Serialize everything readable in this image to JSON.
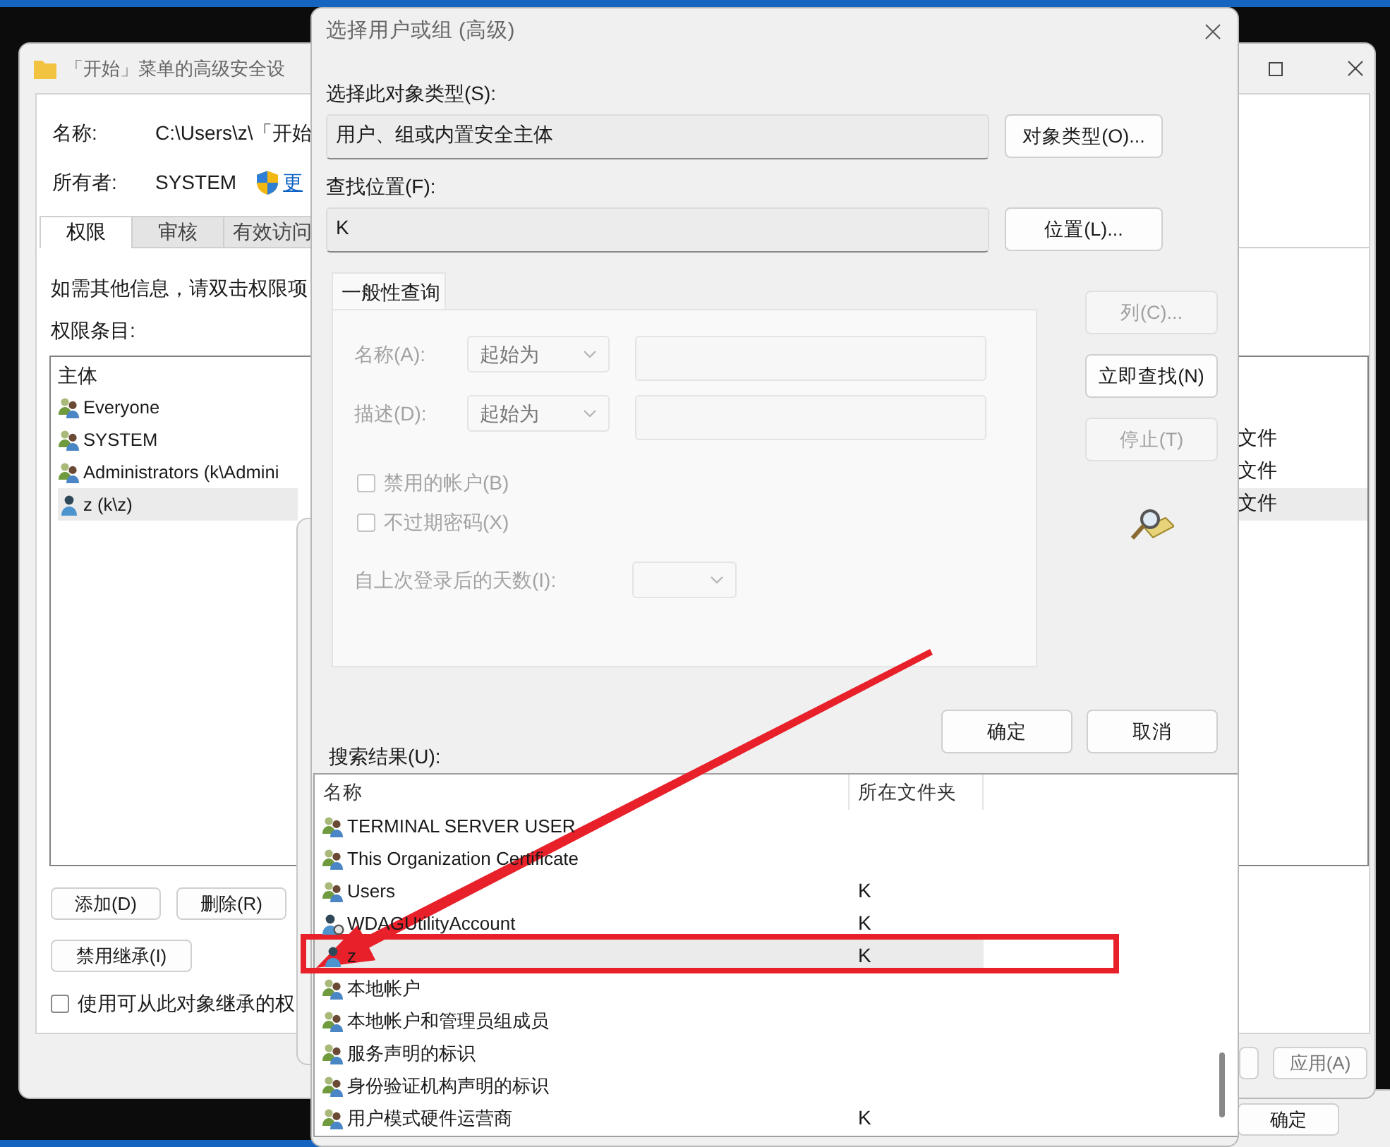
{
  "back_window": {
    "buttons": [
      "确定"
    ]
  },
  "security_window": {
    "title": "「开始」菜单的高级安全设",
    "name_label": "名称:",
    "name_value": "C:\\Users\\z\\「开始",
    "owner_label": "所有者:",
    "owner_value": "SYSTEM",
    "change_link": "更",
    "tabs": [
      {
        "label": "权限",
        "selected": true
      },
      {
        "label": "审核",
        "selected": false
      },
      {
        "label": "有效访问",
        "selected": false
      }
    ],
    "info_text": "如需其他信息，请双击权限项",
    "entries_label": "权限条目:",
    "entries": {
      "columns": [
        "主体"
      ],
      "rows": [
        {
          "kind": "group",
          "principal": "Everyone",
          "selected": false
        },
        {
          "kind": "group",
          "principal": "SYSTEM",
          "column_2": "文件",
          "selected": false
        },
        {
          "kind": "group",
          "principal": "Administrators (k\\Admini",
          "column_2": "文件",
          "selected": false
        },
        {
          "kind": "user",
          "principal": "z (k\\z)",
          "column_2": "文件",
          "selected": true
        }
      ]
    },
    "buttons": [
      "添加(D)",
      "删除(R)"
    ],
    "inherit_button": "禁用继承(I)",
    "inherit_checkbox": {
      "label": "使用可从此对象继承的权",
      "checked": false
    },
    "footer_buttons": [
      "应用(A)"
    ]
  },
  "dialog": {
    "title": "选择用户或组 (高级)",
    "object_type": {
      "label": "选择此对象类型(S):",
      "value": "用户、组或内置安全主体",
      "button": "对象类型(O)..."
    },
    "location": {
      "label": "查找位置(F):",
      "value": "K",
      "button": "位置(L)..."
    },
    "query_tab": {
      "label": "一般性查询",
      "selected": true
    },
    "query": {
      "disabled": true,
      "name_row": {
        "label": "名称(A):",
        "mode": "起始为"
      },
      "description_row": {
        "label": "描述(D):",
        "mode": "起始为"
      },
      "checkboxes": [
        {
          "label": "禁用的帐户(B)",
          "checked": false
        },
        {
          "label": "不过期密码(X)",
          "checked": false
        }
      ],
      "days_label": "自上次登录后的天数(I):"
    },
    "side_buttons": [
      {
        "label": "列(C)...",
        "disabled": true
      },
      {
        "label": "立即查找(N)",
        "disabled": false
      },
      {
        "label": "停止(T)",
        "disabled": true
      }
    ],
    "ok_button": "确定",
    "cancel_button": "取消",
    "results_label": "搜索结果(U):",
    "results": {
      "columns": [
        "名称",
        "所在文件夹"
      ],
      "rows": [
        {
          "kind": "group",
          "name": "TERMINAL SERVER USER",
          "selected": false
        },
        {
          "kind": "group",
          "name": "This Organization Certificate",
          "selected": false
        },
        {
          "kind": "group",
          "name": "Users",
          "folder": "K",
          "selected": false
        },
        {
          "kind": "service",
          "name": "WDAGUtilityAccount",
          "folder": "K",
          "selected": false
        },
        {
          "kind": "user",
          "name": "z",
          "folder": "K",
          "selected": true
        },
        {
          "kind": "group",
          "name": "本地帐户",
          "selected": false
        },
        {
          "kind": "group",
          "name": "本地帐户和管理员组成员",
          "selected": false
        },
        {
          "kind": "group",
          "name": "服务声明的标识",
          "selected": false
        },
        {
          "kind": "group",
          "name": "身份验证机构声明的标识",
          "selected": false
        },
        {
          "kind": "group",
          "name": "用户模式硬件运营商",
          "folder": "K",
          "selected": false
        }
      ]
    }
  },
  "annotations": {
    "highlight_box": true,
    "arrow": true
  }
}
